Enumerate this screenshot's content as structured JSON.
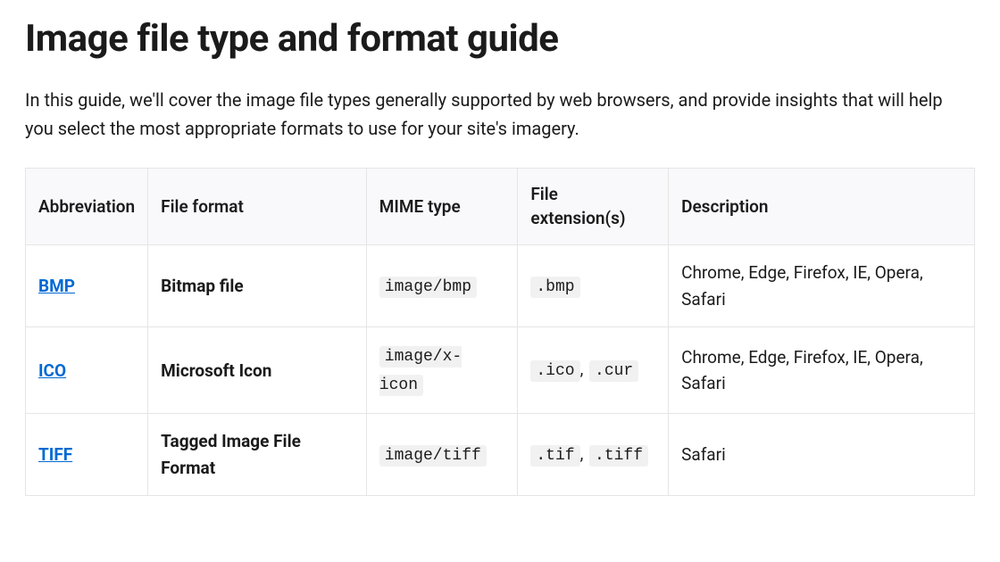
{
  "title": "Image file type and format guide",
  "intro": "In this guide, we'll cover the image file types generally supported by web browsers, and provide insights that will help you select the most appropriate formats to use for your site's imagery.",
  "table": {
    "headers": {
      "abbr": "Abbreviation",
      "format": "File format",
      "mime": "MIME type",
      "ext": "File extension(s)",
      "desc": "Description"
    },
    "rows": [
      {
        "abbr": "BMP",
        "format": "Bitmap file",
        "mime": "image/bmp",
        "ext": [
          ".bmp"
        ],
        "desc": "Chrome, Edge, Firefox, IE, Opera, Safari"
      },
      {
        "abbr": "ICO",
        "format": "Microsoft Icon",
        "mime": "image/x-icon",
        "ext": [
          ".ico",
          ".cur"
        ],
        "desc": "Chrome, Edge, Firefox, IE, Opera, Safari"
      },
      {
        "abbr": "TIFF",
        "format": "Tagged Image File Format",
        "mime": "image/tiff",
        "ext": [
          ".tif",
          ".tiff"
        ],
        "desc": "Safari"
      }
    ]
  }
}
